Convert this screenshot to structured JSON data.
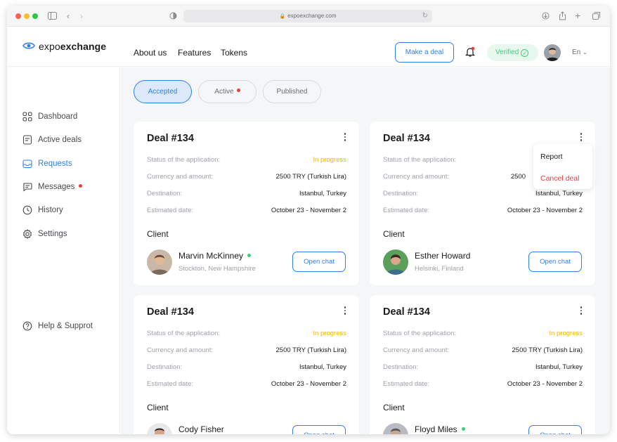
{
  "browser": {
    "url": "expoexchange.com"
  },
  "brand": {
    "name_light": "expo",
    "name_bold": "exchange"
  },
  "nav": {
    "about": "About us",
    "features": "Features",
    "tokens": "Tokens"
  },
  "header": {
    "make_deal": "Make a deal",
    "verified": "Verified",
    "language": "En"
  },
  "sidebar": {
    "items": [
      {
        "label": "Dashboard",
        "icon": "grid-icon"
      },
      {
        "label": "Active deals",
        "icon": "document-icon"
      },
      {
        "label": "Requests",
        "icon": "inbox-icon"
      },
      {
        "label": "Messages",
        "icon": "chat-icon"
      },
      {
        "label": "History",
        "icon": "clock-icon"
      },
      {
        "label": "Settings",
        "icon": "gear-icon"
      }
    ],
    "help": "Help & Supprot"
  },
  "tabs": {
    "accepted": "Accepted",
    "active": "Active",
    "published": "Published"
  },
  "labels": {
    "status": "Status of the application:",
    "currency": "Currency and amount:",
    "destination": "Destination:",
    "date": "Estimated date:",
    "client": "Client",
    "open_chat": "Open chat"
  },
  "deals": [
    {
      "title": "Deal #134",
      "status": "In progress",
      "amount": "2500 TRY (Turkish Lira)",
      "destination": "Istanbul, Turkey",
      "date": "October 23 - November 2",
      "client_name": "Marvin McKinney",
      "client_location": "Stockton, New Hampshire"
    },
    {
      "title": "Deal #134",
      "status": "",
      "amount": "2500",
      "destination": "Istanbul, Turkey",
      "date": "October 23 - November 2",
      "client_name": "Esther Howard",
      "client_location": "Helsinki, Finland"
    },
    {
      "title": "Deal #134",
      "status": "In progress",
      "amount": "2500 TRY (Turkish Lira)",
      "destination": "Istanbul, Turkey",
      "date": "October 23 - November 2",
      "client_name": "Cody Fisher",
      "client_location": ""
    },
    {
      "title": "Deal #134",
      "status": "In progress",
      "amount": "2500 TRY (Turkish Lira)",
      "destination": "Istanbul, Turkey",
      "date": "October 23 - November 2",
      "client_name": "Floyd Miles",
      "client_location": ""
    }
  ],
  "dropdown": {
    "report": "Report",
    "cancel": "Cancel deal"
  },
  "colors": {
    "accent": "#2f80ed",
    "progress": "#f2b400",
    "online": "#3ecf7a",
    "danger": "#eb3b3b"
  }
}
